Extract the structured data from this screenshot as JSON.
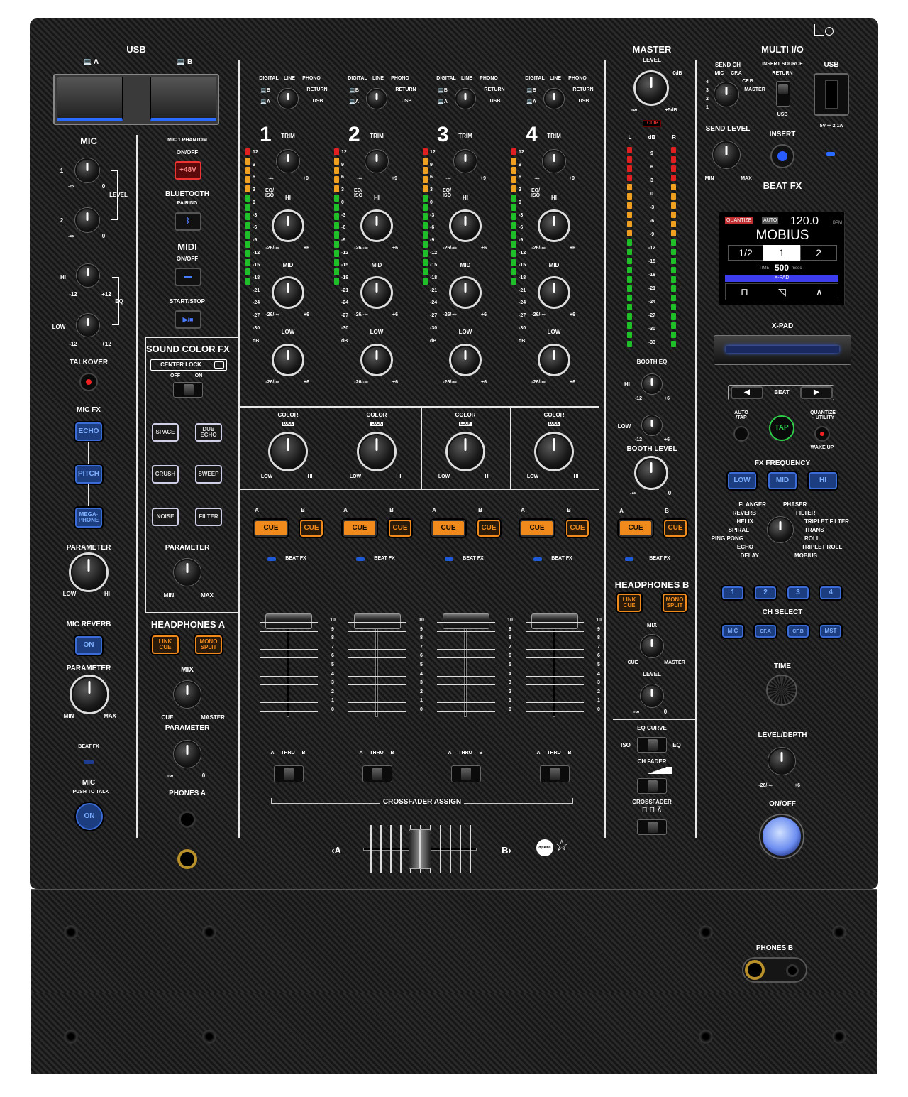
{
  "top": {
    "usb": "USB",
    "usb_a": "A",
    "usb_b": "B",
    "mic": "MIC",
    "level": "LEVEL",
    "eq": "EQ",
    "talkover": "TALKOVER",
    "mic_fx": "MIC FX",
    "echo": "ECHO",
    "pitch": "PITCH",
    "megaphone": "MEGA-\nPHONE",
    "parameter": "PARAMETER",
    "low": "LOW",
    "hi": "HI",
    "min": "MIN",
    "max": "MAX",
    "mic_reverb": "MIC REVERB",
    "on": "ON",
    "beat_fx": "BEAT FX",
    "mic2": "MIC",
    "push_to_talk": "PUSH TO TALK",
    "hi2": "HI",
    "low2": "LOW",
    "n1": "1",
    "n2": "2",
    "minus_inf": "-∞",
    "zero": "0",
    "m12": "-12",
    "p12": "+12"
  },
  "mid_left": {
    "mic1_phantom": "MIC 1 PHANTOM",
    "on_off": "ON/OFF",
    "p48v": "+48V",
    "bluetooth": "BLUETOOTH",
    "pairing": "PAIRING",
    "midi": "MIDI",
    "midi_onoff": "ON/OFF",
    "start_stop": "START/STOP",
    "sound_color_fx": "SOUND COLOR FX",
    "center_lock": "CENTER LOCK",
    "off": "OFF",
    "on": "ON",
    "space": "SPACE",
    "dub_echo": "DUB\nECHO",
    "crush": "CRUSH",
    "sweep": "SWEEP",
    "noise": "NOISE",
    "filter": "FILTER",
    "parameter": "PARAMETER",
    "min": "MIN",
    "max": "MAX",
    "headphones_a": "HEADPHONES A",
    "link_cue": "LINK\nCUE",
    "mono_split": "MONO\nSPLIT",
    "mix": "MIX",
    "cue": "CUE",
    "master": "MASTER",
    "parameter2": "PARAMETER",
    "minus_inf": "-∞",
    "zero": "0",
    "phones_a": "PHONES A"
  },
  "channels": [
    {
      "num": "1",
      "digital": "DIGITAL",
      "line": "LINE",
      "phono": "PHONO",
      "b": "B",
      "a": "A",
      "return": "RETURN",
      "usb": "USB",
      "trim": "TRIM",
      "eqiso": "EQ/\nISO",
      "hi": "HI",
      "mid": "MID",
      "low": "LOW",
      "color": "COLOR",
      "lock": "LOCK",
      "clow": "LOW",
      "chi": "HI",
      "cue_a": "A",
      "cue_b": "B",
      "cue": "CUE",
      "beatfx": "BEAT FX",
      "thru_a": "A",
      "thru": "THRU",
      "thru_b": "B"
    },
    {
      "num": "2",
      "digital": "DIGITAL",
      "line": "LINE",
      "phono": "PHONO",
      "b": "B",
      "a": "A",
      "return": "RETURN",
      "usb": "USB",
      "trim": "TRIM",
      "eqiso": "EQ/\nISO",
      "hi": "HI",
      "mid": "MID",
      "low": "LOW",
      "color": "COLOR",
      "lock": "LOCK",
      "clow": "LOW",
      "chi": "HI",
      "cue_a": "A",
      "cue_b": "B",
      "cue": "CUE",
      "beatfx": "BEAT FX",
      "thru_a": "A",
      "thru": "THRU",
      "thru_b": "B"
    },
    {
      "num": "3",
      "digital": "DIGITAL",
      "line": "LINE",
      "phono": "PHONO",
      "b": "B",
      "a": "A",
      "return": "RETURN",
      "usb": "USB",
      "trim": "TRIM",
      "eqiso": "EQ/\nISO",
      "hi": "HI",
      "mid": "MID",
      "low": "LOW",
      "color": "COLOR",
      "lock": "LOCK",
      "clow": "LOW",
      "chi": "HI",
      "cue_a": "A",
      "cue_b": "B",
      "cue": "CUE",
      "beatfx": "BEAT FX",
      "thru_a": "A",
      "thru": "THRU",
      "thru_b": "B"
    },
    {
      "num": "4",
      "digital": "DIGITAL",
      "line": "LINE",
      "phono": "PHONO",
      "b": "B",
      "a": "A",
      "return": "RETURN",
      "usb": "USB",
      "trim": "TRIM",
      "eqiso": "EQ/\nISO",
      "hi": "HI",
      "mid": "MID",
      "low": "LOW",
      "color": "COLOR",
      "lock": "LOCK",
      "clow": "LOW",
      "chi": "HI",
      "cue_a": "A",
      "cue_b": "B",
      "cue": "CUE",
      "beatfx": "BEAT FX",
      "thru_a": "A",
      "thru": "THRU",
      "thru_b": "B"
    }
  ],
  "meter_scale": [
    "12",
    "9",
    "6",
    "3",
    "0",
    "-3",
    "-6",
    "-9",
    "-12",
    "-15",
    "-18",
    "-21",
    "-24",
    "-27",
    "-30",
    "dB"
  ],
  "fader_scale": [
    "10",
    "9",
    "8",
    "7",
    "6",
    "5",
    "4",
    "3",
    "2",
    "1",
    "0"
  ],
  "knob_marks": {
    "trim_min": "-∞",
    "trim_max": "+9",
    "eq_min": "-26/-∞",
    "eq_max": "+6"
  },
  "crossfader": {
    "assign": "CROSSFADER ASSIGN",
    "a": "A",
    "b": "B",
    "left_arrow": "‹",
    "right_arrow": "›"
  },
  "master": {
    "title": "MASTER",
    "level": "LEVEL",
    "zero_db": "0dB",
    "minus_inf": "-∞",
    "plus5": "+5dB",
    "clip": "CLIP",
    "l": "L",
    "db": "dB",
    "r": "R",
    "scale": [
      "9",
      "6",
      "3",
      "0",
      "-3",
      "-6",
      "-9",
      "-12",
      "-15",
      "-18",
      "-21",
      "-24",
      "-27",
      "-30",
      "-33"
    ],
    "booth_eq": "BOOTH EQ",
    "hi": "HI",
    "low": "LOW",
    "m12": "-12",
    "p6": "+6",
    "booth_level": "BOOTH LEVEL",
    "zero": "0",
    "cue_a": "A",
    "cue_b": "B",
    "cue": "CUE",
    "beat_fx": "BEAT FX",
    "headphones_b": "HEADPHONES B",
    "link_cue": "LINK\nCUE",
    "mono_split": "MONO\nSPLIT",
    "mix": "MIX",
    "cue_lbl": "CUE",
    "master_lbl": "MASTER",
    "level2": "LEVEL",
    "eq_curve": "EQ CURVE",
    "iso": "ISO",
    "eq": "EQ",
    "ch_fader": "CH FADER",
    "crossfader": "CROSSFADER"
  },
  "multi_io": {
    "title": "MULTI I/O",
    "send_ch": "SEND CH",
    "mic": "MIC",
    "cfa": "CF.A",
    "cfb": "CF.B",
    "master": "MASTER",
    "n4": "4",
    "n3": "3",
    "n2": "2",
    "n1": "1",
    "insert_source": "INSERT SOURCE",
    "return": "RETURN",
    "usb": "USB",
    "usb2": "USB",
    "send_level": "SEND LEVEL",
    "min": "MIN",
    "max": "MAX",
    "insert": "INSERT",
    "power": "5V ⎓ 2.1A"
  },
  "beat_fx": {
    "title": "BEAT FX",
    "quantize": "QUANTIZE",
    "auto": "AUTO",
    "bpm_value": "120.0",
    "bpm_unit": "BPM",
    "effect": "MOBIUS",
    "beat_1_2": "1/2",
    "beat_1": "1",
    "beat_2": "2",
    "time_label": "TIME",
    "time_value": "500",
    "time_unit": "msec",
    "xpad": "X-PAD",
    "xpad_label": "X-PAD",
    "beat": "BEAT",
    "auto_tap": "AUTO\n/TAP",
    "tap": "TAP",
    "quantize_utility": "QUANTIZE\n– UTILITY",
    "wake_up": "WAKE UP",
    "fx_frequency": "FX FREQUENCY",
    "low": "LOW",
    "mid": "MID",
    "hi": "HI",
    "effects_left": [
      "FLANGER",
      "REVERB",
      "HELIX",
      "SPIRAL",
      "PING PONG",
      "ECHO",
      "DELAY"
    ],
    "effects_right": [
      "PHASER",
      "FILTER",
      "TRIPLET FILTER",
      "TRANS",
      "ROLL",
      "TRIPLET ROLL",
      "MOBIUS"
    ],
    "ch1": "1",
    "ch2": "2",
    "ch3": "3",
    "ch4": "4",
    "ch_select": "CH SELECT",
    "mic": "MIC",
    "cfa": "CF.A",
    "cfb": "CF.B",
    "mst": "MST",
    "time": "TIME",
    "level_depth": "LEVEL/DEPTH",
    "m26": "-26/-∞",
    "p6": "+6",
    "on_off": "ON/OFF"
  },
  "bottom": {
    "phones_b": "PHONES B",
    "logo": "djskins"
  },
  "colors": {
    "cue_orange": "#f08a1c",
    "fx_blue": "#3a6bd6",
    "panel": "#1d1d1d",
    "meter_green": "#1fbf2a",
    "meter_orange": "#f0a020",
    "meter_red": "#e02020",
    "screen_accent": "#3d3df0"
  }
}
